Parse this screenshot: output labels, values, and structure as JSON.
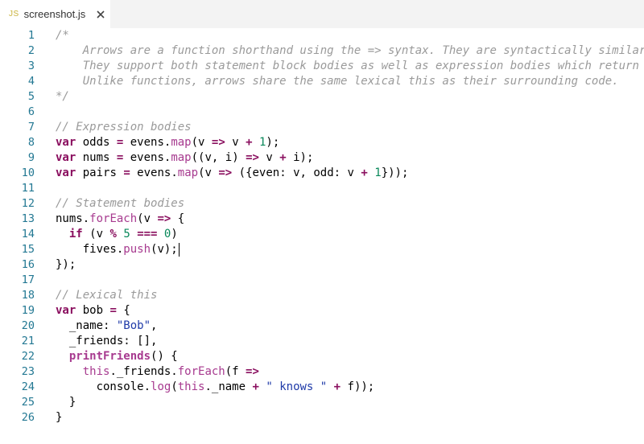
{
  "tab": {
    "icon_label": "JS",
    "filename": "screenshot.js"
  },
  "colors": {
    "comment": "#9a9a9a",
    "keyword": "#8a0f5f",
    "method": "#a73a8f",
    "number": "#09885a",
    "string": "#1f3aa8",
    "plain": "#000000",
    "line_number": "#237893"
  },
  "editor": {
    "lines": [
      {
        "n": "1",
        "tokens": [
          [
            "c",
            "/*"
          ]
        ]
      },
      {
        "n": "2",
        "tokens": [
          [
            "c",
            "    Arrows are a function shorthand using the => syntax. They are syntactically similar"
          ]
        ]
      },
      {
        "n": "3",
        "tokens": [
          [
            "c",
            "    They support both statement block bodies as well as expression bodies which return"
          ]
        ]
      },
      {
        "n": "4",
        "tokens": [
          [
            "c",
            "    Unlike functions, arrows share the same lexical this as their surrounding code."
          ]
        ]
      },
      {
        "n": "5",
        "tokens": [
          [
            "c",
            "*/"
          ]
        ]
      },
      {
        "n": "6",
        "tokens": []
      },
      {
        "n": "7",
        "tokens": [
          [
            "c",
            "// Expression bodies"
          ]
        ]
      },
      {
        "n": "8",
        "tokens": [
          [
            "k",
            "var"
          ],
          [
            "p",
            " odds "
          ],
          [
            "k",
            "="
          ],
          [
            "p",
            " evens."
          ],
          [
            "m",
            "map"
          ],
          [
            "p",
            "(v "
          ],
          [
            "k",
            "=>"
          ],
          [
            "p",
            " v "
          ],
          [
            "k",
            "+"
          ],
          [
            "p",
            " "
          ],
          [
            "n",
            "1"
          ],
          [
            "p",
            ");"
          ]
        ]
      },
      {
        "n": "9",
        "tokens": [
          [
            "k",
            "var"
          ],
          [
            "p",
            " nums "
          ],
          [
            "k",
            "="
          ],
          [
            "p",
            " evens."
          ],
          [
            "m",
            "map"
          ],
          [
            "p",
            "((v, i) "
          ],
          [
            "k",
            "=>"
          ],
          [
            "p",
            " v "
          ],
          [
            "k",
            "+"
          ],
          [
            "p",
            " i);"
          ]
        ]
      },
      {
        "n": "10",
        "tokens": [
          [
            "k",
            "var"
          ],
          [
            "p",
            " pairs "
          ],
          [
            "k",
            "="
          ],
          [
            "p",
            " evens."
          ],
          [
            "m",
            "map"
          ],
          [
            "p",
            "(v "
          ],
          [
            "k",
            "=>"
          ],
          [
            "p",
            " ({even: v, odd: v "
          ],
          [
            "k",
            "+"
          ],
          [
            "p",
            " "
          ],
          [
            "n",
            "1"
          ],
          [
            "p",
            "}));"
          ]
        ]
      },
      {
        "n": "11",
        "tokens": []
      },
      {
        "n": "12",
        "tokens": [
          [
            "c",
            "// Statement bodies"
          ]
        ]
      },
      {
        "n": "13",
        "tokens": [
          [
            "p",
            "nums."
          ],
          [
            "m",
            "forEach"
          ],
          [
            "p",
            "(v "
          ],
          [
            "k",
            "=>"
          ],
          [
            "p",
            " {"
          ]
        ]
      },
      {
        "n": "14",
        "tokens": [
          [
            "p",
            "  "
          ],
          [
            "k",
            "if"
          ],
          [
            "p",
            " (v "
          ],
          [
            "k",
            "%"
          ],
          [
            "p",
            " "
          ],
          [
            "n",
            "5"
          ],
          [
            "p",
            " "
          ],
          [
            "k",
            "==="
          ],
          [
            "p",
            " "
          ],
          [
            "n",
            "0"
          ],
          [
            "p",
            ")"
          ]
        ]
      },
      {
        "n": "15",
        "tokens": [
          [
            "p",
            "    fives."
          ],
          [
            "m",
            "push"
          ],
          [
            "p",
            "(v);"
          ]
        ]
      },
      {
        "n": "16",
        "tokens": [
          [
            "p",
            "});"
          ]
        ]
      },
      {
        "n": "17",
        "tokens": []
      },
      {
        "n": "18",
        "tokens": [
          [
            "c",
            "// Lexical this"
          ]
        ]
      },
      {
        "n": "19",
        "tokens": [
          [
            "k",
            "var"
          ],
          [
            "p",
            " bob "
          ],
          [
            "k",
            "="
          ],
          [
            "p",
            " {"
          ]
        ]
      },
      {
        "n": "20",
        "tokens": [
          [
            "p",
            "  _name: "
          ],
          [
            "s",
            "\"Bob\""
          ],
          [
            "p",
            ","
          ]
        ]
      },
      {
        "n": "21",
        "tokens": [
          [
            "p",
            "  _friends: [],"
          ]
        ]
      },
      {
        "n": "22",
        "tokens": [
          [
            "p",
            "  "
          ],
          [
            "f",
            "printFriends"
          ],
          [
            "p",
            "() {"
          ]
        ]
      },
      {
        "n": "23",
        "tokens": [
          [
            "p",
            "    "
          ],
          [
            "m",
            "this"
          ],
          [
            "p",
            "._friends."
          ],
          [
            "m",
            "forEach"
          ],
          [
            "p",
            "(f "
          ],
          [
            "k",
            "=>"
          ]
        ]
      },
      {
        "n": "24",
        "tokens": [
          [
            "p",
            "      console."
          ],
          [
            "m",
            "log"
          ],
          [
            "p",
            "("
          ],
          [
            "m",
            "this"
          ],
          [
            "p",
            "._name "
          ],
          [
            "k",
            "+"
          ],
          [
            "p",
            " "
          ],
          [
            "s",
            "\" knows \""
          ],
          [
            "p",
            " "
          ],
          [
            "k",
            "+"
          ],
          [
            "p",
            " f));"
          ]
        ]
      },
      {
        "n": "25",
        "tokens": [
          [
            "p",
            "  }"
          ]
        ]
      },
      {
        "n": "26",
        "tokens": [
          [
            "p",
            "}"
          ]
        ]
      }
    ]
  }
}
